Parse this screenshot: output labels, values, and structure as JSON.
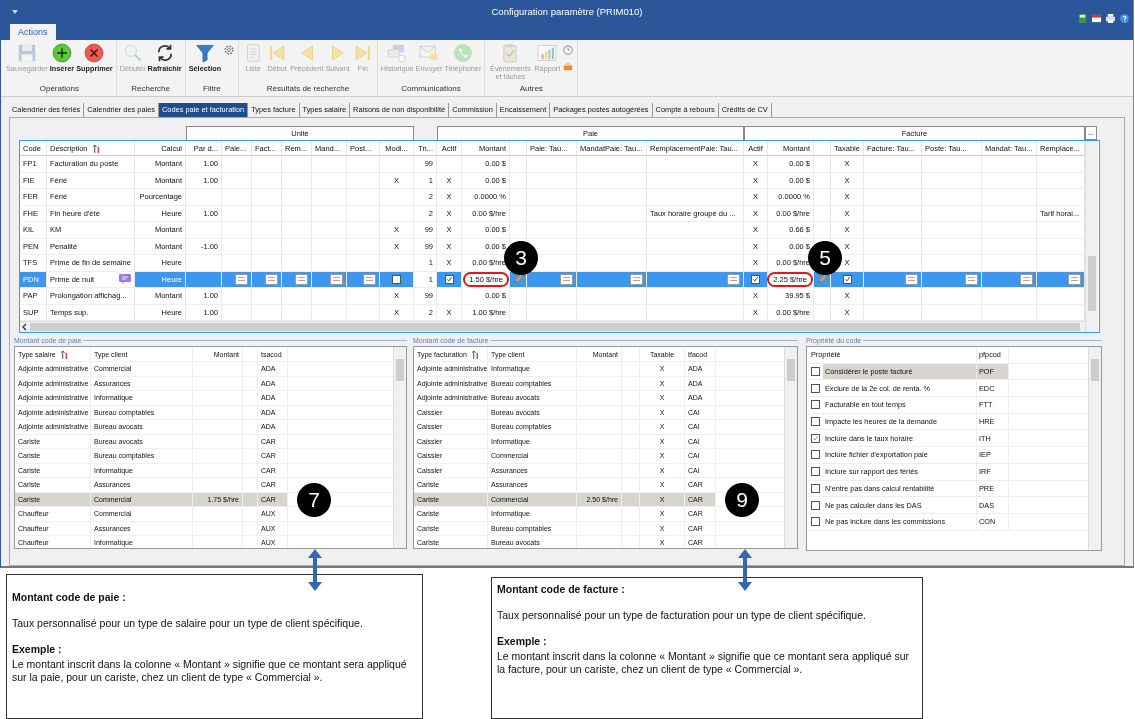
{
  "window": {
    "title": "Configuration paramètre (PRIM010)"
  },
  "ribbon": {
    "tabs": [
      {
        "label": "Actions",
        "selected": true
      }
    ],
    "groups": [
      {
        "label": "Opérations",
        "buttons": [
          {
            "label": "Sauvegarder",
            "disabled": true
          },
          {
            "label": "Insérer",
            "disabled": false
          },
          {
            "label": "Supprimer",
            "disabled": false
          }
        ]
      },
      {
        "label": "Recherche",
        "buttons": [
          {
            "label": "Débuter",
            "disabled": true
          },
          {
            "label": "Rafraîchir",
            "disabled": false
          }
        ]
      },
      {
        "label": "Filtre",
        "buttons": [
          {
            "label": "Sélection",
            "disabled": false
          }
        ]
      },
      {
        "label": "Résultats de recherche",
        "buttons": [
          {
            "label": "Liste",
            "disabled": true
          },
          {
            "label": "Début",
            "disabled": true
          },
          {
            "label": "Précédent",
            "disabled": true
          },
          {
            "label": "Suivant",
            "disabled": true
          },
          {
            "label": "Fin",
            "disabled": true
          }
        ]
      },
      {
        "label": "Communications",
        "buttons": [
          {
            "label": "Historique",
            "disabled": true
          },
          {
            "label": "Envoyer",
            "disabled": true
          },
          {
            "label": "Téléphoner",
            "disabled": true
          }
        ]
      },
      {
        "label": "Autres",
        "buttons": [
          {
            "label": "Événements et tâches",
            "disabled": true
          },
          {
            "label": "Rapport",
            "disabled": true
          }
        ]
      }
    ]
  },
  "tabs": [
    {
      "label": "Calendrier des fériés",
      "selected": false
    },
    {
      "label": "Calendrier des paies",
      "selected": false
    },
    {
      "label": "Codes paie et facturation",
      "selected": true
    },
    {
      "label": "Types facture",
      "selected": false
    },
    {
      "label": "Types salaire",
      "selected": false
    },
    {
      "label": "Raisons de non disponibilité",
      "selected": false
    },
    {
      "label": "Commission",
      "selected": false
    },
    {
      "label": "Encaissement",
      "selected": false
    },
    {
      "label": "Packages postes autogérées",
      "selected": false
    },
    {
      "label": "Compte à rebours",
      "selected": false
    },
    {
      "label": "Crédits de CV",
      "selected": false
    }
  ],
  "grid": {
    "groups": [
      "Unité",
      "Paie",
      "Facture"
    ],
    "column_chooser": "...",
    "columns": [
      "Code",
      "Description",
      "Calcul",
      "Par d...",
      "Paie...",
      "Fact...",
      "Rem...",
      "Mand...",
      "Post...",
      "Modi...",
      "Tri...",
      "Actif",
      "Montant",
      null,
      "Paie: Tau...",
      "MandatPaie: Tau...",
      "RemplacementPaie: Tau...",
      "Actif",
      "Montant",
      null,
      "Taxable",
      "Facture: Tau...",
      "Poste: Tau...",
      "Mandat: Tau...",
      "Remplace..."
    ],
    "rows": [
      {
        "selected": false,
        "cells": [
          "FP1",
          "Facturation du poste",
          "Montant",
          "1.00",
          null,
          null,
          null,
          null,
          null,
          null,
          "99",
          null,
          "0.00 $",
          null,
          null,
          null,
          null,
          "X",
          "0.00 $",
          null,
          "X",
          null,
          null,
          null,
          null
        ]
      },
      {
        "selected": false,
        "cells": [
          "FIE",
          "Férié",
          "Montant",
          "1.00",
          null,
          null,
          null,
          null,
          null,
          "X",
          "1",
          "X",
          "0.00 $",
          null,
          null,
          null,
          null,
          "X",
          "0.00 $",
          null,
          "X",
          null,
          null,
          null,
          null
        ]
      },
      {
        "selected": false,
        "cells": [
          "FER",
          "Férié",
          "Pourcentage",
          null,
          null,
          null,
          null,
          null,
          null,
          null,
          "2",
          "X",
          "0.0000 %",
          null,
          null,
          null,
          null,
          "X",
          "0.0000 %",
          null,
          "X",
          null,
          null,
          null,
          null
        ]
      },
      {
        "selected": false,
        "cells": [
          "FHE",
          "Fin heure d'été",
          "Heure",
          "1.00",
          null,
          null,
          null,
          null,
          null,
          null,
          "2",
          "X",
          "0.00 $/hre",
          null,
          null,
          null,
          "Taux horaire groupé du ...",
          "X",
          "0.00 $/hre",
          null,
          "X",
          null,
          null,
          null,
          "Tarif horai..."
        ]
      },
      {
        "selected": false,
        "cells": [
          "KIL",
          "KM",
          "Montant",
          null,
          null,
          null,
          null,
          null,
          null,
          "X",
          "99",
          "X",
          "0.00 $",
          null,
          null,
          null,
          null,
          "X",
          "0.66 $",
          null,
          "X",
          null,
          null,
          null,
          null
        ]
      },
      {
        "selected": false,
        "cells": [
          "PEN",
          "Penalité",
          "Montant",
          "-1.00",
          null,
          null,
          null,
          null,
          null,
          "X",
          "99",
          "X",
          "0.00 $",
          null,
          null,
          null,
          null,
          "X",
          "0.00 $",
          null,
          "X",
          null,
          null,
          null,
          null
        ]
      },
      {
        "selected": false,
        "cells": [
          "TFS",
          "Prime de fin de semaine",
          "Heure",
          null,
          null,
          null,
          null,
          null,
          null,
          null,
          "1",
          "X",
          "0.00 $/hre",
          null,
          null,
          null,
          null,
          "X",
          "0.00 $/hre",
          null,
          "X",
          null,
          null,
          null,
          null
        ]
      },
      {
        "selected": true,
        "cells": [
          "PDN",
          {
            "kind": "note",
            "text": "Prime de nuit"
          },
          "Heure",
          null,
          {
            "kind": "sql"
          },
          {
            "kind": "sql"
          },
          {
            "kind": "sql"
          },
          {
            "kind": "sql"
          },
          {
            "kind": "sql"
          },
          {
            "kind": "check",
            "checked": false
          },
          {
            "kind": "input",
            "text": "1"
          },
          {
            "kind": "check",
            "checked": true
          },
          {
            "kind": "highlight",
            "text": "1.50 $/hre",
            "callout": "3"
          },
          {
            "kind": "pencil"
          },
          {
            "kind": "sql"
          },
          {
            "kind": "sql"
          },
          {
            "kind": "sql"
          },
          {
            "kind": "check",
            "checked": true
          },
          {
            "kind": "highlight",
            "text": "2.25 $/hre",
            "callout": "5"
          },
          {
            "kind": "pencil"
          },
          {
            "kind": "check",
            "checked": true
          },
          {
            "kind": "sql"
          },
          {
            "kind": "sql"
          },
          {
            "kind": "sql"
          },
          {
            "kind": "sql"
          }
        ]
      },
      {
        "selected": false,
        "cells": [
          "PAP",
          "Prolongation affichag...",
          "Montant",
          "1.00",
          null,
          null,
          null,
          null,
          null,
          "X",
          "99",
          null,
          "0.00 $",
          null,
          null,
          null,
          null,
          "X",
          "39.95 $",
          null,
          "X",
          null,
          null,
          null,
          null
        ]
      },
      {
        "selected": false,
        "cells": [
          "SUP",
          "Temps sup.",
          "Heure",
          "1.00",
          null,
          null,
          null,
          null,
          null,
          "X",
          "2",
          "X",
          "1.00 $/hre",
          null,
          null,
          null,
          null,
          "X",
          "0.00 $/hre",
          null,
          "X",
          null,
          null,
          null,
          null
        ]
      }
    ]
  },
  "pay_amounts": {
    "title": "Montant code de paie",
    "columns": [
      "Type salaire",
      "Type client",
      "Montant",
      null,
      "tsacod"
    ],
    "rows": [
      {
        "selected": false,
        "cells": [
          "Adjointe administrative",
          "Commercial",
          null,
          null,
          "ADA"
        ]
      },
      {
        "selected": false,
        "cells": [
          "Adjointe administrative",
          "Assurances",
          null,
          null,
          "ADA"
        ]
      },
      {
        "selected": false,
        "cells": [
          "Adjointe administrative",
          "Informatique",
          null,
          null,
          "ADA"
        ]
      },
      {
        "selected": false,
        "cells": [
          "Adjointe administrative",
          "Bureau comptables",
          null,
          null,
          "ADA"
        ]
      },
      {
        "selected": false,
        "cells": [
          "Adjointe administrative",
          "Bureau avocats",
          null,
          null,
          "ADA"
        ]
      },
      {
        "selected": false,
        "cells": [
          "Cariste",
          "Bureau avocats",
          null,
          null,
          "CAR"
        ]
      },
      {
        "selected": false,
        "cells": [
          "Cariste",
          "Bureau comptables",
          null,
          null,
          "CAR"
        ]
      },
      {
        "selected": false,
        "cells": [
          "Cariste",
          "Informatique",
          null,
          null,
          "CAR"
        ]
      },
      {
        "selected": false,
        "cells": [
          "Cariste",
          "Assurances",
          null,
          null,
          "CAR"
        ]
      },
      {
        "selected": true,
        "callout": "7",
        "cells": [
          "Cariste",
          "Commercial",
          "1.75 $/hre",
          null,
          "CAR"
        ]
      },
      {
        "selected": false,
        "cells": [
          "Chauffeur",
          "Commercial",
          null,
          null,
          "AUX"
        ]
      },
      {
        "selected": false,
        "cells": [
          "Chauffeur",
          "Assurances",
          null,
          null,
          "AUX"
        ]
      },
      {
        "selected": false,
        "cells": [
          "Chauffeur",
          "Informatique",
          null,
          null,
          "AUX"
        ]
      }
    ]
  },
  "billing_amounts": {
    "title": "Montant code de facture",
    "columns": [
      "Type facturation",
      "Type client",
      "Montant",
      null,
      "Taxable",
      "tfacod"
    ],
    "rows": [
      {
        "selected": false,
        "cells": [
          "Adjointe administrative",
          "Informatique",
          null,
          null,
          "X",
          "ADA"
        ]
      },
      {
        "selected": false,
        "cells": [
          "Adjointe administrative",
          "Bureau comptables",
          null,
          null,
          "X",
          "ADA"
        ]
      },
      {
        "selected": false,
        "cells": [
          "Adjointe administrative",
          "Bureau avocats",
          null,
          null,
          "X",
          "ADA"
        ]
      },
      {
        "selected": false,
        "cells": [
          "Caissier",
          "Bureau avocats",
          null,
          null,
          "X",
          "CAI"
        ]
      },
      {
        "selected": false,
        "cells": [
          "Caissier",
          "Bureau comptables",
          null,
          null,
          "X",
          "CAI"
        ]
      },
      {
        "selected": false,
        "cells": [
          "Caissier",
          "Informatique",
          null,
          null,
          "X",
          "CAI"
        ]
      },
      {
        "selected": false,
        "cells": [
          "Caissier",
          "Commercial",
          null,
          null,
          "X",
          "CAI"
        ]
      },
      {
        "selected": false,
        "cells": [
          "Caissier",
          "Assurances",
          null,
          null,
          "X",
          "CAI"
        ]
      },
      {
        "selected": false,
        "cells": [
          "Cariste",
          "Assurances",
          null,
          null,
          "X",
          "CAR"
        ]
      },
      {
        "selected": true,
        "callout": "9",
        "cells": [
          "Cariste",
          "Commercial",
          "2.50 $/hre",
          null,
          "X",
          "CAR"
        ]
      },
      {
        "selected": false,
        "cells": [
          "Cariste",
          "Informatique",
          null,
          null,
          "X",
          "CAR"
        ]
      },
      {
        "selected": false,
        "cells": [
          "Cariste",
          "Bureau comptables",
          null,
          null,
          "X",
          "CAR"
        ]
      },
      {
        "selected": false,
        "cells": [
          "Cariste",
          "Bureau avocats",
          null,
          null,
          "X",
          "CAR"
        ]
      }
    ]
  },
  "properties": {
    "title": "Propriété du code",
    "columns": [
      "Propriété",
      "pfpcod"
    ],
    "rows": [
      {
        "label": "Considérer le poste facturé",
        "code": "POF",
        "checked": false,
        "selected": true
      },
      {
        "label": "Exclure de la 2e col. de renta. %",
        "code": "EDC",
        "checked": false,
        "selected": false
      },
      {
        "label": "Facturable en tout temps",
        "code": "FTT",
        "checked": false,
        "selected": false
      },
      {
        "label": "Impacte les heures de la demande",
        "code": "HRE",
        "checked": false,
        "selected": false
      },
      {
        "label": "Inclure dans le taux horaire",
        "code": "ITH",
        "checked": true,
        "selected": false
      },
      {
        "label": "Inclure fichier d'exportation paie",
        "code": "IEP",
        "checked": false,
        "selected": false
      },
      {
        "label": "Inclure sur rapport des fériés",
        "code": "IRF",
        "checked": false,
        "selected": false
      },
      {
        "label": "N'entre pas dans calcul rentabilité",
        "code": "PRE",
        "checked": false,
        "selected": false
      },
      {
        "label": "Ne pas calculer dans les DAS",
        "code": "DAS",
        "checked": false,
        "selected": false
      },
      {
        "label": "Ne pas inclure dans les commissions",
        "code": "CON",
        "checked": false,
        "selected": false
      }
    ]
  },
  "notes": [
    {
      "title": "Montant code de paie :",
      "text": "Taux personnalisé pour un type de salaire pour un type de client spécifique.",
      "example_title": "Exemple :",
      "example": "Le montant inscrit dans la colonne « Montant » signifie que ce montant sera appliqué sur la paie, pour un cariste, chez un client de type « Commercial »."
    },
    {
      "title": "Montant code de facture :",
      "text": "Taux personnalisé pour un type de facturation pour un type de client spécifique.",
      "example_title": "Exemple :",
      "example": "Le montant inscrit dans la colonne « Montant » signifie que ce montant sera appliqué sur la facture, pour un cariste, chez un client de type « Commercial »."
    }
  ]
}
